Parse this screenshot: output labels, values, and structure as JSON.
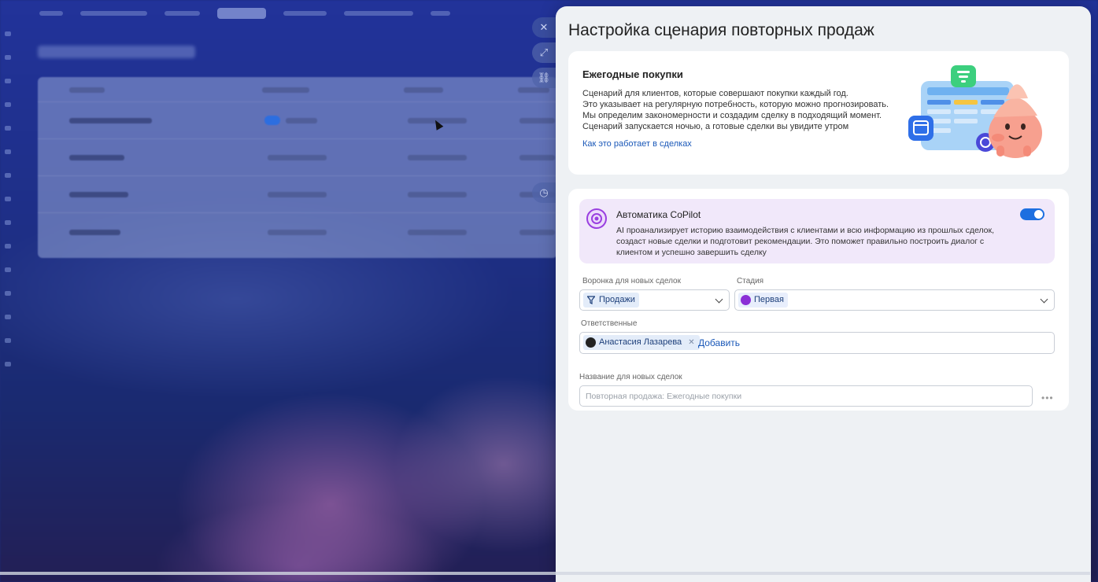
{
  "panel": {
    "title": "Настройка сценария повторных продаж",
    "intro_card": {
      "title": "Ежегодные покупки",
      "description_lines": [
        "Сценарий для клиентов, которые совершают покупки каждый год.",
        "Это указывает на регулярную потребность, которую можно прогнозировать.",
        "Мы определим закономерности и создадим сделку в подходящий момент.",
        "Сценарий запускается ночью, а готовые сделки вы увидите утром"
      ],
      "link": "Как это работает в сделках"
    },
    "copilot": {
      "title": "Автоматика CoPilot",
      "description_lines": [
        "AI проанализирует историю взаимодействия с клиентами и всю информацию из прошлых сделок,",
        "создаст новые сделки и подготовит рекомендации. Это поможет правильно построить диалог с",
        "клиентом и успешно завершить сделку"
      ],
      "enabled": true,
      "toggle_color": "#1d6fe0"
    },
    "funnel": {
      "label": "Воронка для новых сделок",
      "value": "Продажи",
      "icon": "filter-icon"
    },
    "stage": {
      "label": "Стадия",
      "value": "Первая",
      "color": "#8b2fd6"
    },
    "responsible": {
      "label": "Ответственные",
      "person": "Анастасия Лазарева",
      "add_label": "Добавить"
    },
    "deal_name": {
      "label": "Название для новых сделок",
      "placeholder": "Повторная продажа: Ежегодные покупки"
    }
  },
  "side_buttons": [
    {
      "icon": "close-icon",
      "glyph": "✕"
    },
    {
      "icon": "expand-icon",
      "glyph": "⤢"
    },
    {
      "icon": "link-icon",
      "glyph": "⛓"
    },
    {
      "icon": "history-icon",
      "glyph": "◷"
    }
  ]
}
